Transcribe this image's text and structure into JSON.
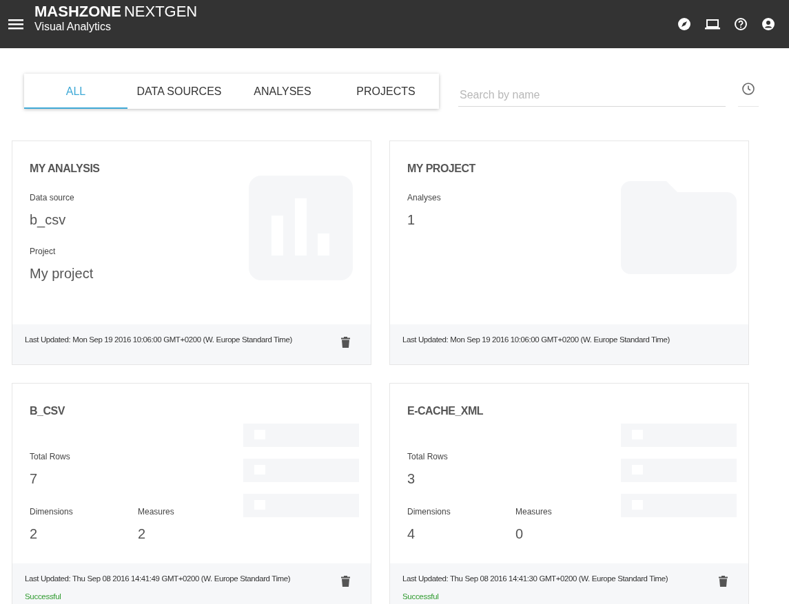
{
  "header": {
    "brand_bold": "MASHZONE",
    "brand_light": "NEXTGEN",
    "subtitle": "Visual Analytics"
  },
  "tabs": [
    {
      "label": "ALL",
      "selected": true
    },
    {
      "label": "DATA SOURCES",
      "selected": false
    },
    {
      "label": "ANALYSES",
      "selected": false
    },
    {
      "label": "PROJECTS",
      "selected": false
    }
  ],
  "search": {
    "placeholder": "Search by name"
  },
  "cards": [
    {
      "kind": "analysis",
      "title": "MY ANALYSIS",
      "fields": [
        {
          "label": "Data source",
          "value": "b_csv"
        },
        {
          "label": "Project",
          "value": "My project"
        }
      ],
      "updated": "Last Updated: Mon Sep 19 2016 10:06:00 GMT+0200 (W. Europe Standard Time)",
      "deletable": true
    },
    {
      "kind": "project",
      "title": "MY PROJECT",
      "fields": [
        {
          "label": "Analyses",
          "value": "1"
        }
      ],
      "updated": "Last Updated: Mon Sep 19 2016 10:06:00 GMT+0200 (W. Europe Standard Time)",
      "deletable": false
    },
    {
      "kind": "datasource",
      "title": "B_CSV",
      "fields": [
        {
          "label": "Total Rows",
          "value": "7"
        },
        {
          "label": "Dimensions",
          "value": "2"
        },
        {
          "label": "Measures",
          "value": "2"
        }
      ],
      "updated": "Last Updated: Thu Sep 08 2016 14:41:49 GMT+0200 (W. Europe Standard Time)",
      "status": "Successful",
      "deletable": true
    },
    {
      "kind": "datasource",
      "title": "E-CACHE_XML",
      "fields": [
        {
          "label": "Total Rows",
          "value": "3"
        },
        {
          "label": "Dimensions",
          "value": "4"
        },
        {
          "label": "Measures",
          "value": "0"
        }
      ],
      "updated": "Last Updated: Thu Sep 08 2016 14:41:30 GMT+0200 (W. Europe Standard Time)",
      "status": "Successful",
      "deletable": true
    }
  ]
}
